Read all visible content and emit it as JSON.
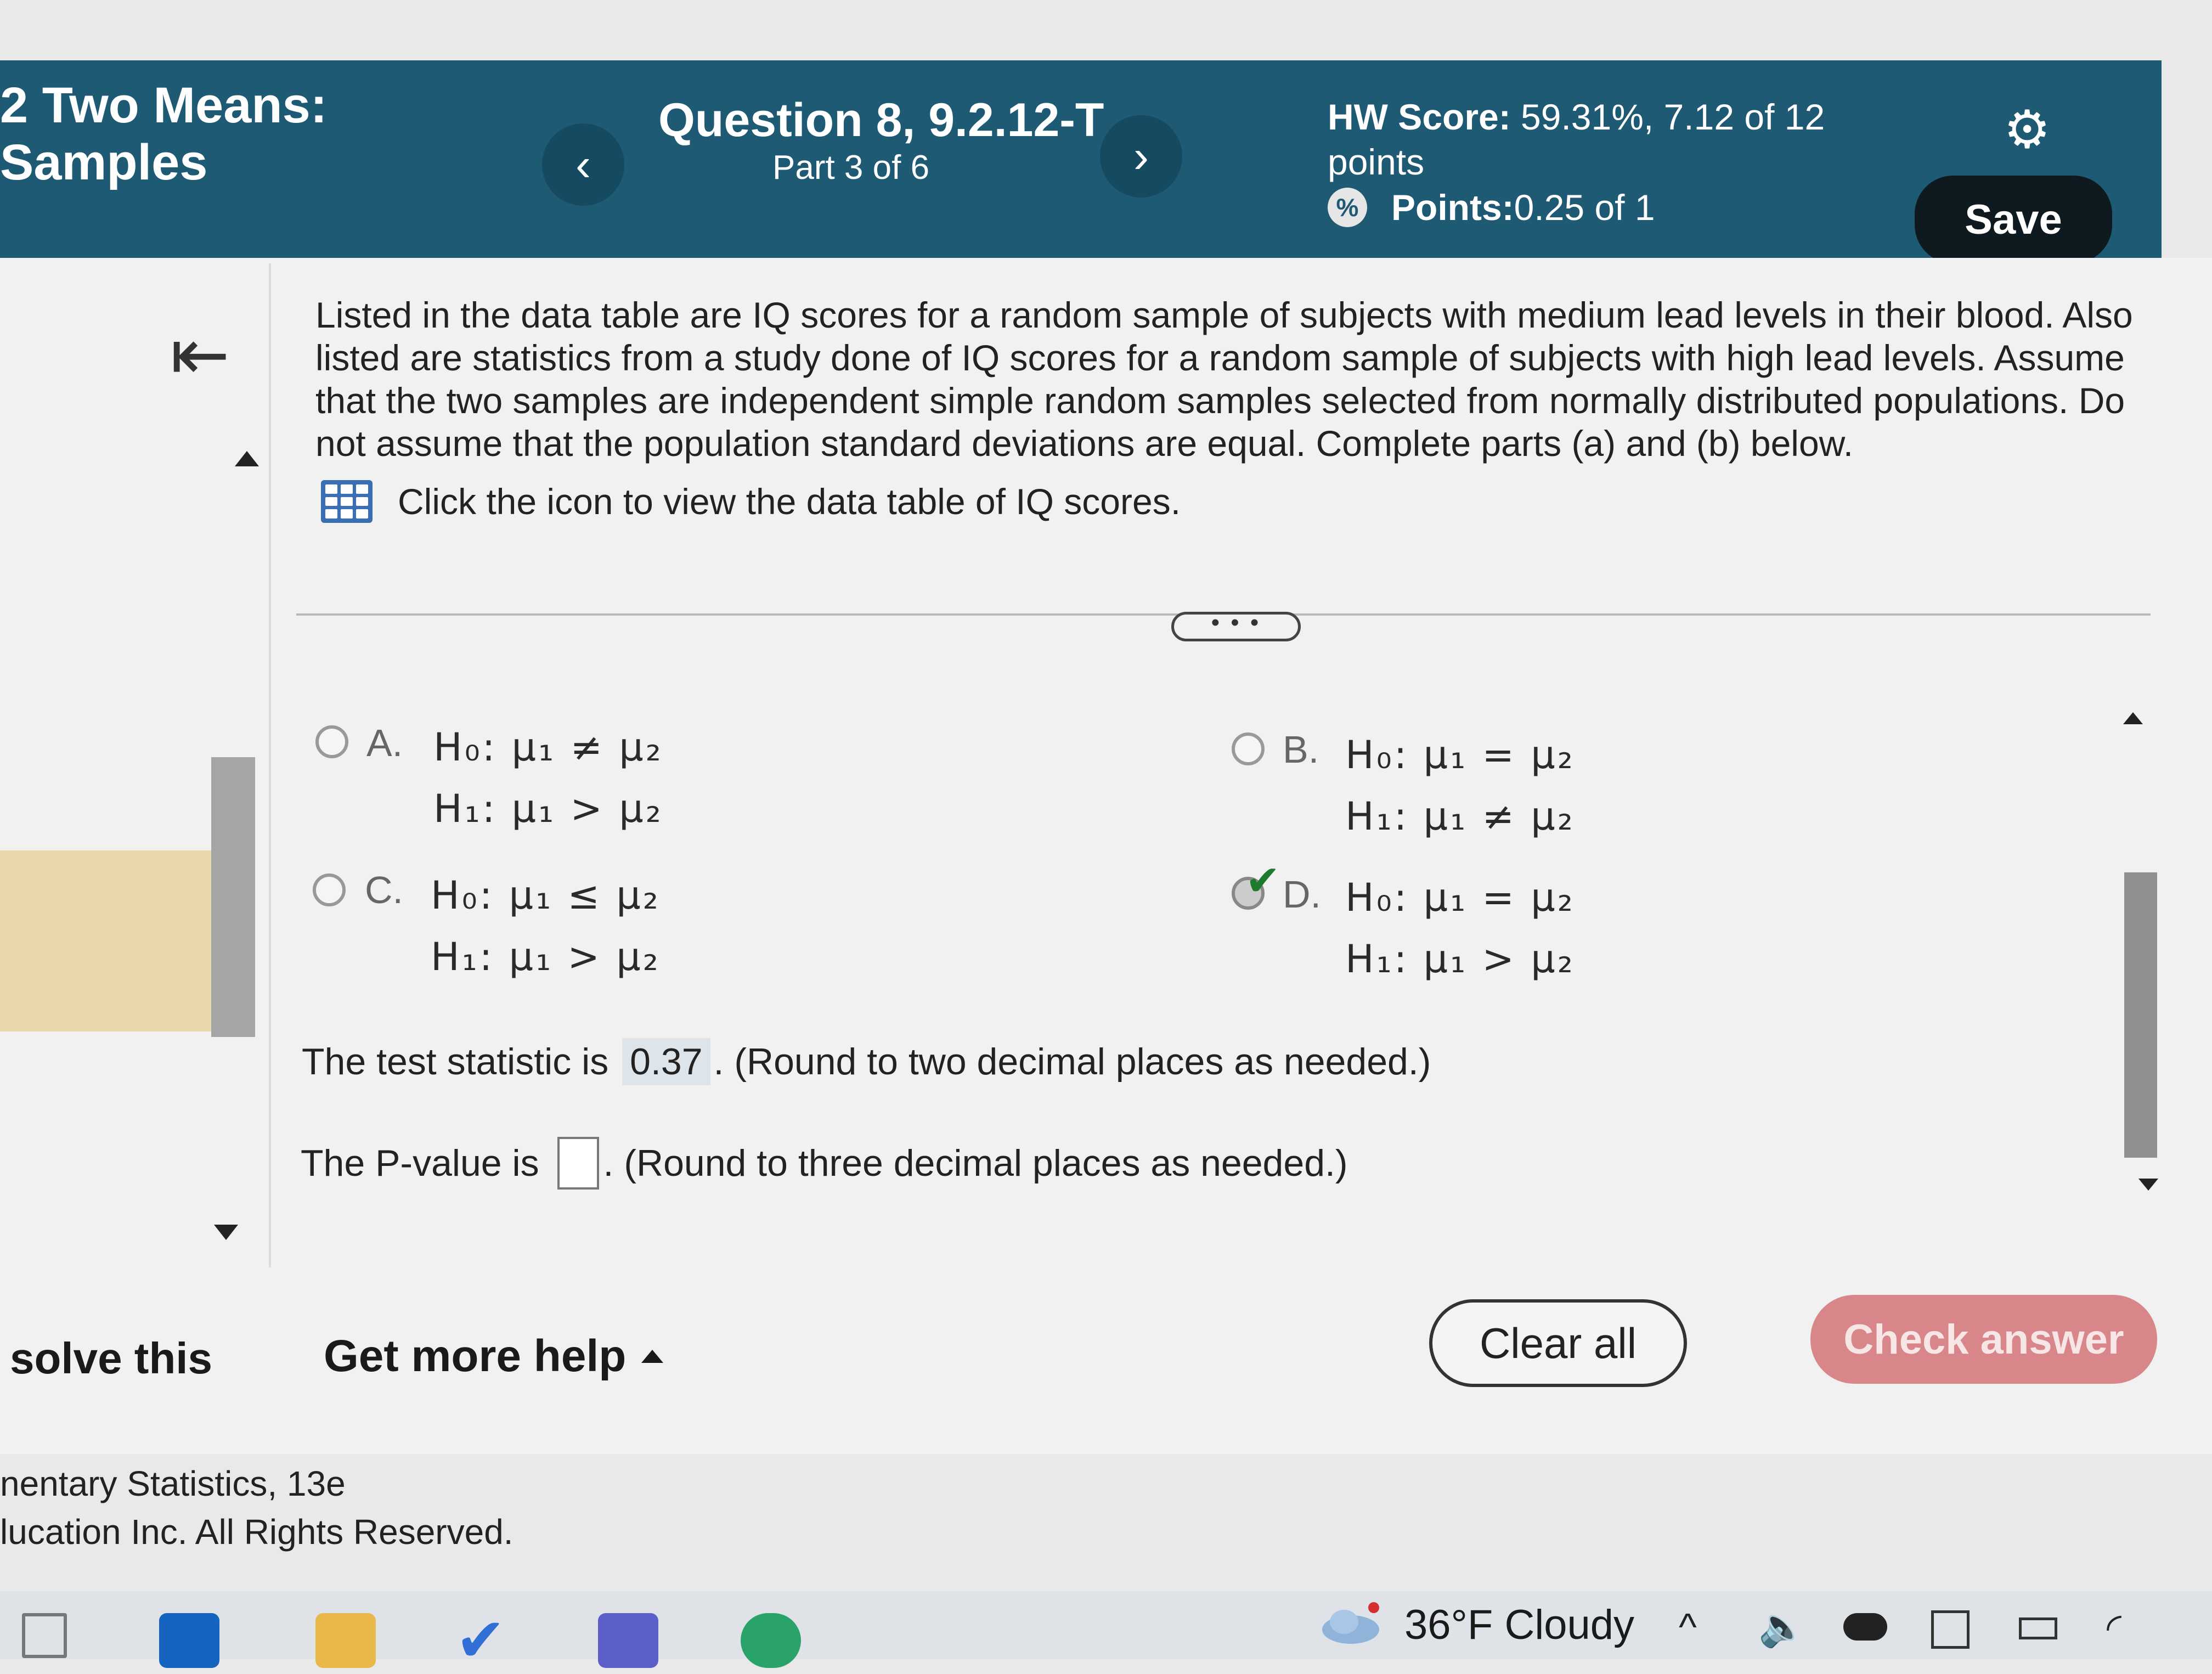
{
  "header": {
    "section_title": "2 Two Means:\nSamples",
    "question_title": "Question 8, 9.2.12-T",
    "question_part": "Part 3 of 6",
    "hw_score_label": "HW Score:",
    "hw_score_value": " 59.31%, 7.12 of 12 points",
    "points_label": "Points:",
    "points_value": " 0.25 of 1",
    "save_label": "Save",
    "prev_icon": "‹",
    "next_icon": "›"
  },
  "problem": {
    "text": "Listed in the data table are IQ scores for a random sample of subjects with medium lead levels in their blood. Also listed are statistics from a study done of IQ scores for a random sample of subjects with high lead levels. Assume that the two samples are independent simple random samples selected from normally distributed populations. Do not assume that the population standard deviations are equal. Complete parts (a) and (b) below.",
    "data_link": "Click the icon to view the data table of IQ scores."
  },
  "more_label": "• • •",
  "options": [
    {
      "letter": "A.",
      "h0": "H₀: μ₁ ≠ μ₂",
      "h1": "H₁: μ₁ > μ₂",
      "selected": false
    },
    {
      "letter": "B.",
      "h0": "H₀: μ₁ = μ₂",
      "h1": "H₁: μ₁ ≠ μ₂",
      "selected": false
    },
    {
      "letter": "C.",
      "h0": "H₀: μ₁ ≤ μ₂",
      "h1": "H₁: μ₁ > μ₂",
      "selected": false
    },
    {
      "letter": "D.",
      "h0": "H₀: μ₁ = μ₂",
      "h1": "H₁: μ₁ > μ₂",
      "selected": true
    }
  ],
  "test_statistic": {
    "prefix": "The test statistic is ",
    "value": "0.37",
    "suffix": ". (Round to two decimal places as needed.)"
  },
  "p_value": {
    "prefix": "The P-value is ",
    "value": "",
    "suffix": ". (Round to three decimal places as needed.)"
  },
  "footer": {
    "solve_label": "solve this",
    "more_help_label": "Get more help",
    "clear_label": "Clear all",
    "check_label": "Check answer",
    "copyright": "nentary Statistics, 13e\nlucation Inc. All Rights Reserved."
  },
  "taskbar": {
    "weather": "36°F  Cloudy"
  }
}
